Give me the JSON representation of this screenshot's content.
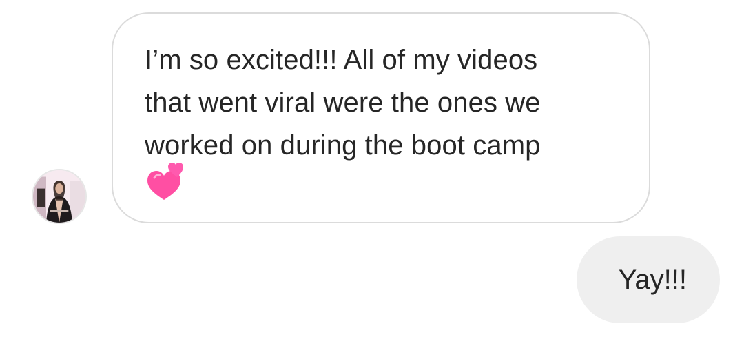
{
  "thread": {
    "received_message": {
      "lines": [
        "I’m so excited!!! All of my videos",
        "that went viral were the ones we",
        "worked on during the boot camp"
      ],
      "emoji": "💕"
    },
    "sent_message": {
      "text": "Yay!!!"
    }
  },
  "icons": {
    "avatar": "sender-avatar",
    "emoji": "two-hearts-icon"
  },
  "colors": {
    "received_bubble_border": "#dbdbdb",
    "sent_bubble_background": "#efefef",
    "text": "#262626",
    "heart_pink": "#ff4fa3"
  }
}
